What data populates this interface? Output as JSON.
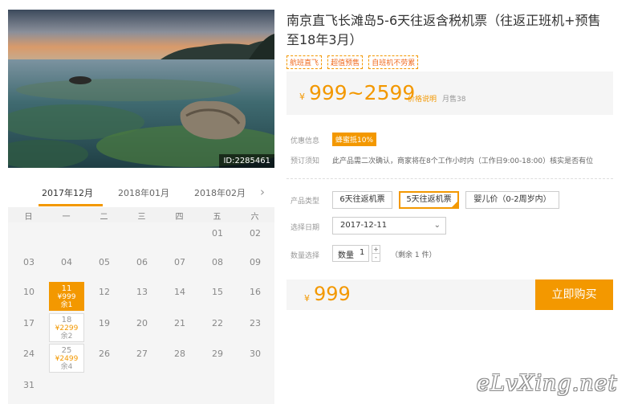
{
  "photo": {
    "id_label": "ID:2285461"
  },
  "calendar": {
    "months": [
      "2017年12月",
      "2018年01月",
      "2018年02月"
    ],
    "next_icon": "chevron-right-icon",
    "weekdays": [
      "日",
      "一",
      "二",
      "三",
      "四",
      "五",
      "六"
    ],
    "rows": [
      [
        "",
        "",
        "",
        "",
        "",
        "01",
        "02"
      ],
      [
        "03",
        "04",
        "05",
        "06",
        "07",
        "08",
        "09"
      ],
      [
        "10",
        "11",
        "12",
        "13",
        "14",
        "15",
        "16"
      ],
      [
        "17",
        "18",
        "19",
        "20",
        "21",
        "22",
        "23"
      ],
      [
        "24",
        "25",
        "26",
        "27",
        "28",
        "29",
        "30"
      ],
      [
        "31",
        "",
        "",
        "",
        "",
        "",
        ""
      ]
    ],
    "available": [
      {
        "day": "11",
        "price": "¥999",
        "stock": "余1",
        "selected": true
      },
      {
        "day": "18",
        "price": "¥2299",
        "stock": "余2",
        "selected": false
      },
      {
        "day": "25",
        "price": "¥2499",
        "stock": "余4",
        "selected": false
      }
    ]
  },
  "product": {
    "title": "南京直飞长滩岛5-6天往返含税机票（往返正班机+预售至18年3月）",
    "tags": [
      "航班直飞",
      "超值预售",
      "自班机不劳累"
    ],
    "currency": "¥",
    "price_range": "999~2599",
    "price_note_link": "价格说明",
    "monthly_sales": "月售38"
  },
  "info": {
    "offer_label": "优惠信息",
    "coupon": "蜂蜜抵10%",
    "notice_label": "预订须知",
    "notice_text": "此产品需二次确认，商家将在8个工作小时内（工作日9:00-18:00）核实是否有位"
  },
  "options": {
    "type_label": "产品类型",
    "types": [
      "6天往返机票",
      "5天往返机票",
      "婴儿价（0-2周岁内）"
    ],
    "selected_type": "5天往返机票",
    "date_label": "选择日期",
    "date_value": "2017-12-11",
    "qty_label": "数量选择",
    "qty_field_label": "数量",
    "qty_value": "1",
    "qty_plus": "+",
    "qty_minus": "-",
    "remaining": "（剩余 1 件）"
  },
  "buy": {
    "currency": "¥",
    "total": "999",
    "button_label": "立即购买"
  },
  "watermark": "eLvXing.net",
  "colors": {
    "accent": "#f39800",
    "tag_text": "#f06a1d",
    "panel_bg": "#f5f5f5"
  }
}
